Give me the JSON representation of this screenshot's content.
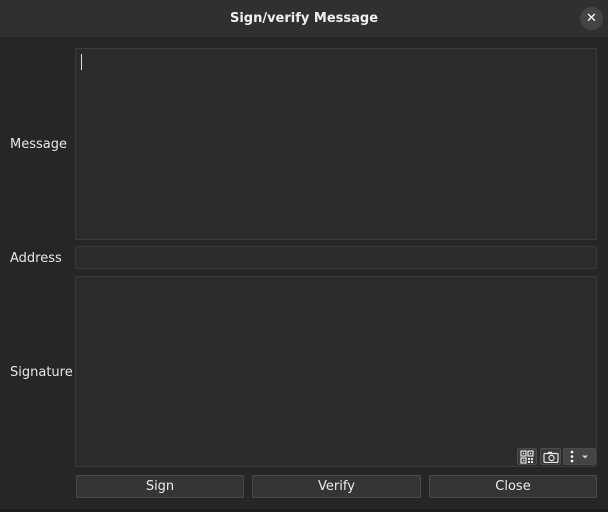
{
  "window": {
    "title": "Sign/verify Message",
    "close_icon": "close-icon"
  },
  "form": {
    "message_label": "Message",
    "message_value": "",
    "address_label": "Address",
    "address_value": "",
    "signature_label": "Signature",
    "signature_value": ""
  },
  "signature_tools": {
    "qr_icon": "qr-code-icon",
    "camera_icon": "camera-icon",
    "menu_icon": "kebab-menu-icon",
    "dropdown_icon": "chevron-down-icon"
  },
  "buttons": {
    "sign": "Sign",
    "verify": "Verify",
    "close": "Close"
  },
  "colors": {
    "background": "#262626",
    "titlebar": "#303030",
    "field": "#2b2b2b"
  }
}
